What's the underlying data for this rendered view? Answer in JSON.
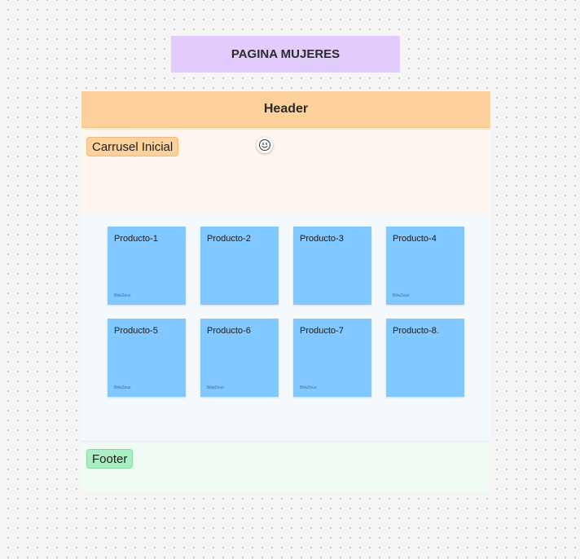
{
  "page_title": "PAGINA MUJERES",
  "sections": {
    "header": {
      "label": "Header"
    },
    "carrusel": {
      "label": "Carrusel Inicial"
    },
    "footer": {
      "label": "Footer"
    }
  },
  "products": [
    {
      "label": "Producto-1",
      "author": "BitwZeus"
    },
    {
      "label": "Producto-2",
      "author": ""
    },
    {
      "label": "Producto-3",
      "author": ""
    },
    {
      "label": "Producto-4",
      "author": "BitwZeus"
    },
    {
      "label": "Producto-5",
      "author": "BitwZeus"
    },
    {
      "label": "Producto-6",
      "author": "BitwZeus"
    },
    {
      "label": "Producto-7",
      "author": "BitwZeus"
    },
    {
      "label": "Producto-8.",
      "author": ""
    }
  ],
  "colors": {
    "canvas": "#f5f5f5",
    "title_sticky": "#e2ccfd",
    "header": "#fdd19c",
    "carrusel_bg": "#fef6ef",
    "products_bg": "#f4f9fe",
    "footer_bg": "#f0fcf3",
    "product_sticky": "#80c8ff",
    "footer_tag": "#adedc4"
  },
  "icons": {
    "reaction": "smiley-face-icon"
  }
}
